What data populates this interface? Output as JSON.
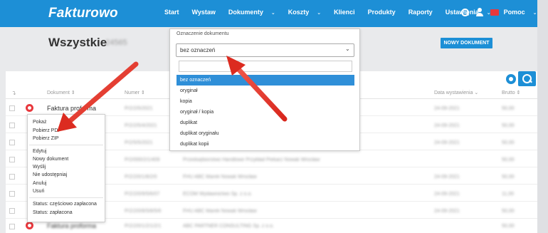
{
  "brand": {
    "logo": "Fakturowo"
  },
  "nav": {
    "items": [
      {
        "label": "Start",
        "dropdown": false
      },
      {
        "label": "Wystaw",
        "dropdown": false
      },
      {
        "label": "Dokumenty",
        "dropdown": true
      },
      {
        "label": "Koszty",
        "dropdown": true
      },
      {
        "label": "Klienci",
        "dropdown": false
      },
      {
        "label": "Produkty",
        "dropdown": false
      },
      {
        "label": "Raporty",
        "dropdown": false
      },
      {
        "label": "Ustawienia",
        "dropdown": true
      },
      {
        "label": "Pomoc",
        "dropdown": true
      }
    ],
    "icons": [
      "search-icon",
      "user-icon",
      "mail-icon"
    ]
  },
  "page": {
    "title": "Wszystkie",
    "count": "24565",
    "new_doc_button": "NOWY DOKUMENT"
  },
  "filter": {
    "label": "Oznaczenie dokumentu",
    "selected": "bez oznaczeń",
    "search_value": "",
    "options": [
      "bez oznaczeń",
      "oryginał",
      "kopia",
      "oryginał / kopia",
      "duplikat",
      "duplikat oryginału",
      "duplikat kopii"
    ],
    "selected_index": 0
  },
  "table": {
    "columns": [
      {
        "label": "Dokument",
        "sort": "⇕"
      },
      {
        "label": "Numer",
        "sort": "⇕"
      },
      {
        "label": "Data wystawienia",
        "sort": "⌄"
      },
      {
        "label": "Brutto",
        "sort": "⇕"
      }
    ],
    "rows": [
      {
        "document": "Faktura proforma",
        "number": "P/2/2/5/2021",
        "client": "",
        "date": "24-09-2021",
        "gross": "50,00"
      },
      {
        "document": "",
        "number": "P/2/2/5/4/2021",
        "client": "",
        "date": "24-09-2021",
        "gross": "50,00"
      },
      {
        "document": "",
        "number": "P/2/5/5/2021",
        "client": "",
        "date": "24-09-2021",
        "gross": "50,00"
      },
      {
        "document": "",
        "number": "P/2/000/2/1/409",
        "client": "Przedsiębiorstwo Handlowe Przykład Piekarz Nowak Wrocław",
        "date": "24-09-2021",
        "gross": "50,00"
      },
      {
        "document": "",
        "number": "P/2/2/0/1/8/2/0",
        "client": "FHU ABC Marek Nowak Wrocław",
        "date": "24-09-2021",
        "gross": "50,00"
      },
      {
        "document": "",
        "number": "P/2/2/0/9/5/6/07",
        "client": "ECOM Wydawnictwo Sp. z o.o.",
        "date": "24-09-2021",
        "gross": "11,00"
      },
      {
        "document": "",
        "number": "P/2/2/0/8/5/8/5/6",
        "client": "FHU ABC Marek Nowak Wrocław",
        "date": "24-09-2021",
        "gross": "50,00"
      },
      {
        "document": "Faktura proforma",
        "number": "P/2/2/0/1/2/1/2/1",
        "client": "ABC PARTNER CONSULTING Sp. z o.o.",
        "date": "24-09-2021",
        "gross": "50,00"
      }
    ]
  },
  "context_menu": {
    "groups": [
      [
        "Pokaż",
        "Pobierz PDF",
        "Pobierz ZIP"
      ],
      [
        "Edytuj",
        "Nowy dokument",
        "Wyślij",
        "Nie udostępniaj",
        "Anuluj",
        "Usuń"
      ],
      [
        "Status: częściowo zapłacona",
        "Status: zapłacona"
      ]
    ]
  },
  "colors": {
    "brand_blue": "#1d8fd6",
    "accent_red": "#e8383d",
    "selected_option": "#2f8fd8"
  }
}
